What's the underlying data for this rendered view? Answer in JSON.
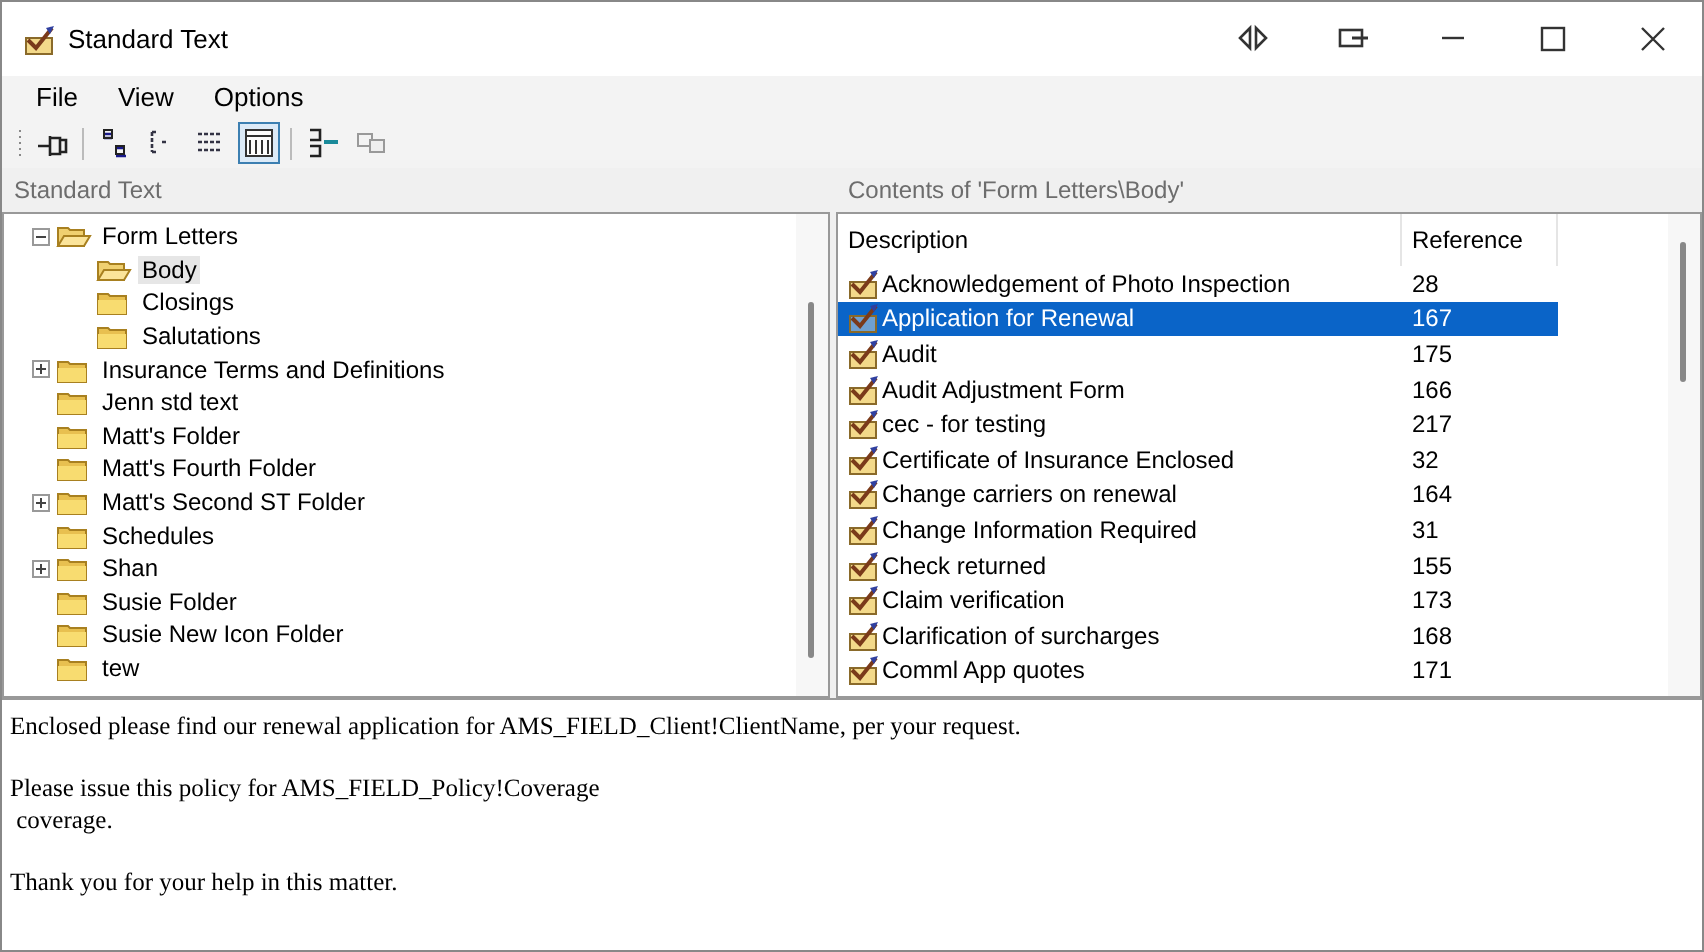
{
  "window": {
    "title": "Standard Text"
  },
  "menu": [
    "File",
    "View",
    "Options"
  ],
  "toolbar": [
    {
      "kind": "pin",
      "pressed": false
    },
    {
      "kind": "sep"
    },
    {
      "kind": "letters",
      "pressed": false
    },
    {
      "kind": "tree-small",
      "pressed": false
    },
    {
      "kind": "tree-list",
      "pressed": false
    },
    {
      "kind": "details",
      "pressed": true
    },
    {
      "kind": "sep"
    },
    {
      "kind": "insert",
      "pressed": false
    },
    {
      "kind": "windows",
      "pressed": false
    }
  ],
  "tree_pane": {
    "title": "Standard Text",
    "items": [
      {
        "label": "Form Letters",
        "expanded": true,
        "selected": false,
        "children": [
          {
            "label": "Body",
            "selected": true
          },
          {
            "label": "Closings",
            "selected": false
          },
          {
            "label": "Salutations",
            "selected": false
          }
        ]
      },
      {
        "label": "Insurance Terms and Definitions",
        "expanded": false,
        "selected": false
      },
      {
        "label": "Jenn std text",
        "selected": false
      },
      {
        "label": "Matt's Folder",
        "selected": false
      },
      {
        "label": "Matt's Fourth Folder",
        "selected": false
      },
      {
        "label": "Matt's Second ST Folder",
        "expanded": false,
        "selected": false
      },
      {
        "label": "Schedules",
        "selected": false
      },
      {
        "label": "Shan",
        "expanded": false,
        "selected": false
      },
      {
        "label": "Susie Folder",
        "selected": false
      },
      {
        "label": "Susie New Icon Folder",
        "selected": false
      },
      {
        "label": "tew",
        "selected": false
      }
    ]
  },
  "list_pane": {
    "title": "Contents of 'Form Letters\\Body'",
    "columns": [
      "Description",
      "Reference"
    ],
    "rows": [
      {
        "description": "Acknowledgement of Photo Inspection",
        "reference": "28",
        "selected": false
      },
      {
        "description": "Application for Renewal",
        "reference": "167",
        "selected": true
      },
      {
        "description": "Audit",
        "reference": "175",
        "selected": false
      },
      {
        "description": "Audit Adjustment Form",
        "reference": "166",
        "selected": false
      },
      {
        "description": "cec - for testing",
        "reference": "217",
        "selected": false
      },
      {
        "description": "Certificate of Insurance Enclosed",
        "reference": "32",
        "selected": false
      },
      {
        "description": "Change carriers on renewal",
        "reference": "164",
        "selected": false
      },
      {
        "description": "Change Information Required",
        "reference": "31",
        "selected": false
      },
      {
        "description": "Check returned",
        "reference": "155",
        "selected": false
      },
      {
        "description": "Claim verification",
        "reference": "173",
        "selected": false
      },
      {
        "description": "Clarification of surcharges",
        "reference": "168",
        "selected": false
      },
      {
        "description": "Comml App quotes",
        "reference": "171",
        "selected": false
      }
    ]
  },
  "preview": {
    "paragraphs": [
      "Enclosed please find our renewal application for AMS_FIELD_Client!ClientName, per your request.",
      "Please issue this policy for AMS_FIELD_Policy!Coverage\n coverage.",
      "Thank you for your help in this matter."
    ]
  }
}
